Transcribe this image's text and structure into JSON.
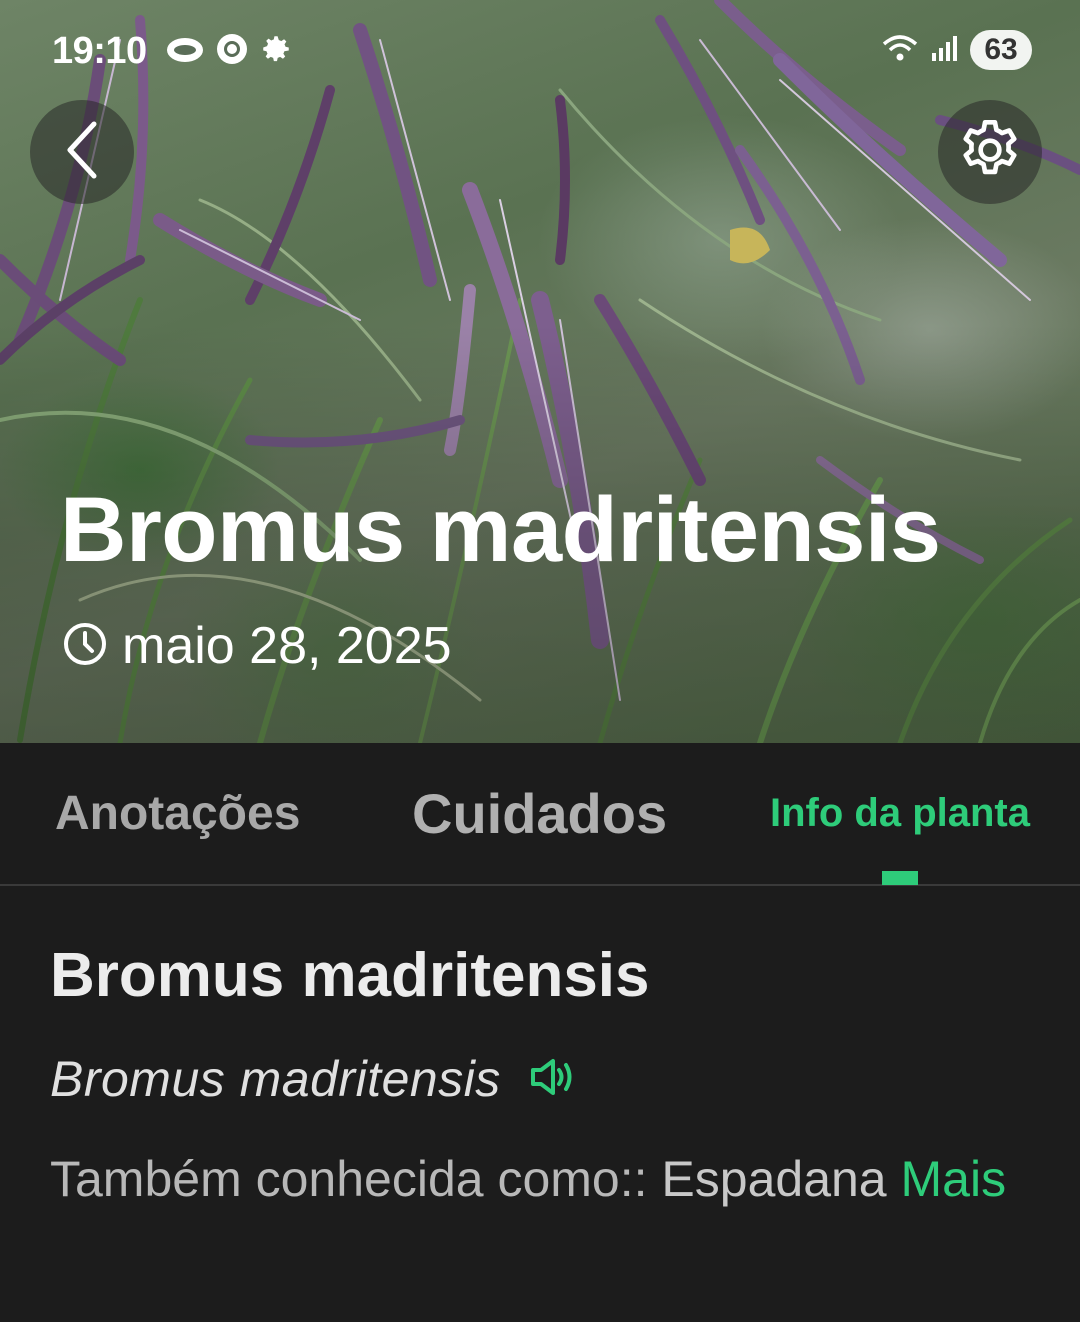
{
  "status_bar": {
    "time": "19:10",
    "battery": "63",
    "left_icons": [
      "cloud-icon",
      "chrome-icon",
      "gear-icon"
    ],
    "right_icons": [
      "wifi-icon",
      "signal-icon",
      "battery-icon"
    ]
  },
  "header": {
    "back_icon": "chevron-left-icon",
    "settings_icon": "gear-icon",
    "title": "Bromus madritensis",
    "date_icon": "clock-icon",
    "date": "maio 28, 2025"
  },
  "tabs": [
    {
      "label": "Anotações",
      "active": false
    },
    {
      "label": "Cuidados",
      "active": false
    },
    {
      "label": "Info da planta",
      "active": true
    }
  ],
  "plant_info": {
    "name": "Bromus madritensis",
    "scientific_name": "Bromus madritensis",
    "speaker_icon": "speaker-icon",
    "also_known_label": "Também conhecida como::",
    "also_known_value": "Espadana",
    "more_label": "Mais"
  },
  "colors": {
    "accent": "#2ecc7a",
    "background": "#1c1c1c",
    "tab_divider": "#3a3a3a"
  }
}
